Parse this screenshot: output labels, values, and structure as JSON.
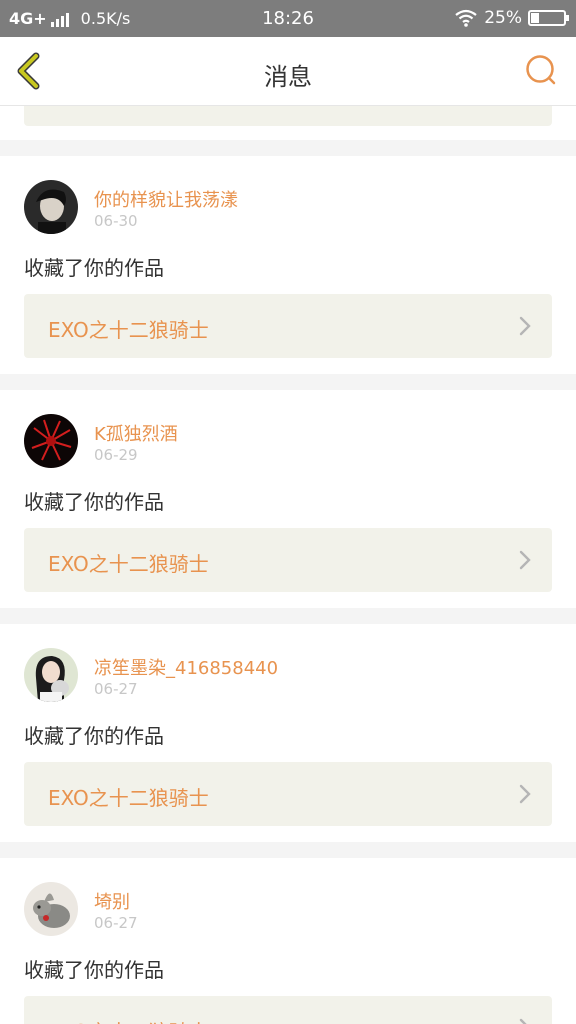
{
  "status_bar": {
    "network": "4G+",
    "speed": "0.5K/s",
    "time": "18:26",
    "battery_text": "25%",
    "battery_level": 0.25
  },
  "nav": {
    "title": "消息",
    "back_icon": "chevron-left-icon",
    "search_icon": "search-icon",
    "accent_color": "#e8934f",
    "back_color": "#c8c820"
  },
  "notifications": [
    {
      "username": "你的样貌让我荡漾",
      "date": "06-30",
      "action": "收藏了你的作品",
      "work_title": "EXO之十二狼骑士"
    },
    {
      "username": "K孤独烈酒",
      "date": "06-29",
      "action": "收藏了你的作品",
      "work_title": "EXO之十二狼骑士"
    },
    {
      "username": "凉笙墨染_416858440",
      "date": "06-27",
      "action": "收藏了你的作品",
      "work_title": "EXO之十二狼骑士"
    },
    {
      "username": "埼别",
      "date": "06-27",
      "action": "收藏了你的作品",
      "work_title": "EXO之十二狼骑士"
    }
  ]
}
